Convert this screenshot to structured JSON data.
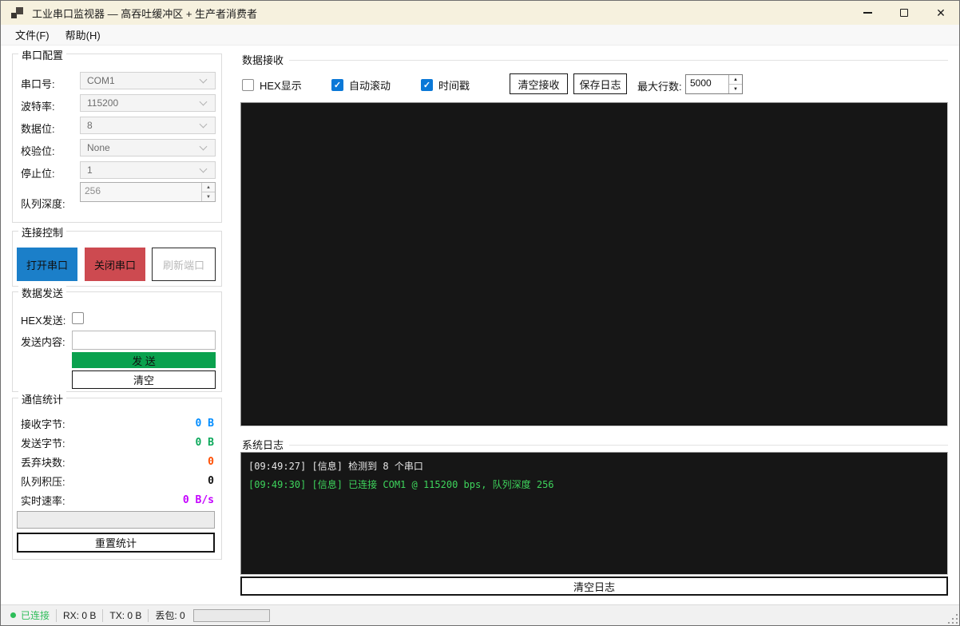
{
  "window": {
    "title": "工业串口监视器 — 高吞吐缓冲区 + 生产者消费者"
  },
  "menu": {
    "file": "文件(F)",
    "help": "帮助(H)"
  },
  "colors": {
    "open_btn": "#1b7fc9",
    "close_btn": "#cd4a50",
    "send_btn": "#0aa14e",
    "checkbox_checked": "#0a78d7",
    "connected": "#2ebd59",
    "console_bg": "#161616"
  },
  "serial_config": {
    "title": "串口配置",
    "fields": [
      {
        "label": "串口号:",
        "value": "COM1"
      },
      {
        "label": "波特率:",
        "value": "115200"
      },
      {
        "label": "数据位:",
        "value": "8"
      },
      {
        "label": "校验位:",
        "value": "None"
      },
      {
        "label": "停止位:",
        "value": "1"
      }
    ],
    "queue_depth": {
      "label": "队列深度:",
      "value": "256"
    }
  },
  "connection": {
    "title": "连接控制",
    "open_btn": "打开串口",
    "close_btn": "关闭串口",
    "refresh_btn": "刷新端口"
  },
  "send": {
    "title": "数据发送",
    "hex_label": "HEX发送:",
    "content_label": "发送内容:",
    "input_value": "",
    "send_btn": "发 送",
    "clear_btn": "清空"
  },
  "stats": {
    "title": "通信统计",
    "rows": [
      {
        "label": "接收字节:",
        "value": "0 B",
        "color": "#008cff"
      },
      {
        "label": "发送字节:",
        "value": "0 B",
        "color": "#0aa85a"
      },
      {
        "label": "丢弃块数:",
        "value": "0",
        "color": "#ff4d00"
      },
      {
        "label": "队列积压:",
        "value": "0",
        "color": "#111111"
      },
      {
        "label": "实时速率:",
        "value": "0 B/s",
        "color": "#c400ff"
      }
    ],
    "reset_btn": "重置统计"
  },
  "receive": {
    "title": "数据接收",
    "hex_display": "HEX显示",
    "autoscroll": "自动滚动",
    "timestamp": "时间戳",
    "clear_btn": "清空接收",
    "save_btn": "保存日志",
    "max_lines_label": "最大行数:",
    "max_lines_value": "5000",
    "content": ""
  },
  "syslog": {
    "title": "系统日志",
    "lines": [
      {
        "text": "[09:49:27] [信息] 检测到 8 个串口",
        "color": "#e6e6e6"
      },
      {
        "text": "[09:49:30] [信息] 已连接 COM1 @ 115200 bps, 队列深度 256",
        "color": "#3ed45c"
      }
    ],
    "clear_btn": "清空日志"
  },
  "statusbar": {
    "connection": "已连接",
    "rx": "RX: 0 B",
    "tx": "TX: 0 B",
    "loss": "丢包: 0"
  }
}
